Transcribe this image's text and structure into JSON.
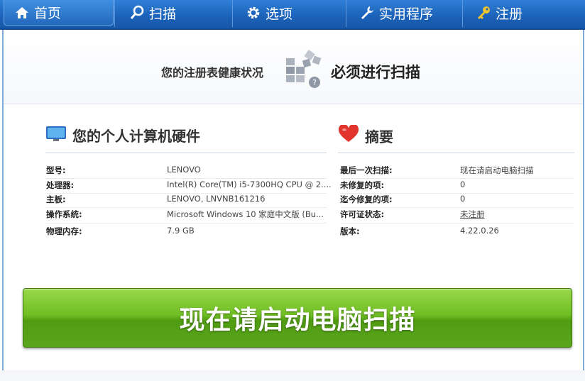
{
  "nav": {
    "tabs": [
      {
        "label": "首页",
        "icon": "home-icon"
      },
      {
        "label": "扫描",
        "icon": "magnifier-icon"
      },
      {
        "label": "选项",
        "icon": "gear-icon"
      },
      {
        "label": "实用程序",
        "icon": "wrench-icon"
      },
      {
        "label": "注册",
        "icon": "key-icon"
      }
    ]
  },
  "health": {
    "left_text": "您的注册表健康状况",
    "right_text": "必须进行扫描"
  },
  "hardware": {
    "title": "您的个人计算机硬件",
    "rows": [
      {
        "key": "型号:",
        "value": "LENOVO"
      },
      {
        "key": "处理器:",
        "value": "Intel(R) Core(TM) i5-7300HQ CPU @ 2...."
      },
      {
        "key": "主板:",
        "value": "LENOVO, LNVNB161216"
      },
      {
        "key": "操作系统:",
        "value": "Microsoft Windows 10 家庭中文版 (Bu..."
      },
      {
        "key": "物理内存:",
        "value": "7.9 GB"
      }
    ]
  },
  "summary": {
    "title": "摘要",
    "rows": [
      {
        "key": "最后一次扫描:",
        "value": "现在请启动电脑扫描"
      },
      {
        "key": "未修复的项:",
        "value": "0"
      },
      {
        "key": "迄今修复的项:",
        "value": "0"
      },
      {
        "key": "许可证状态:",
        "value": "未注册"
      },
      {
        "key": "版本:",
        "value": "4.22.0.26"
      }
    ]
  },
  "scan_button": {
    "label": "现在请启动电脑扫描"
  },
  "colors": {
    "nav": "#1b61b8",
    "button": "#6fbe23",
    "link": "#1a5fc8"
  }
}
